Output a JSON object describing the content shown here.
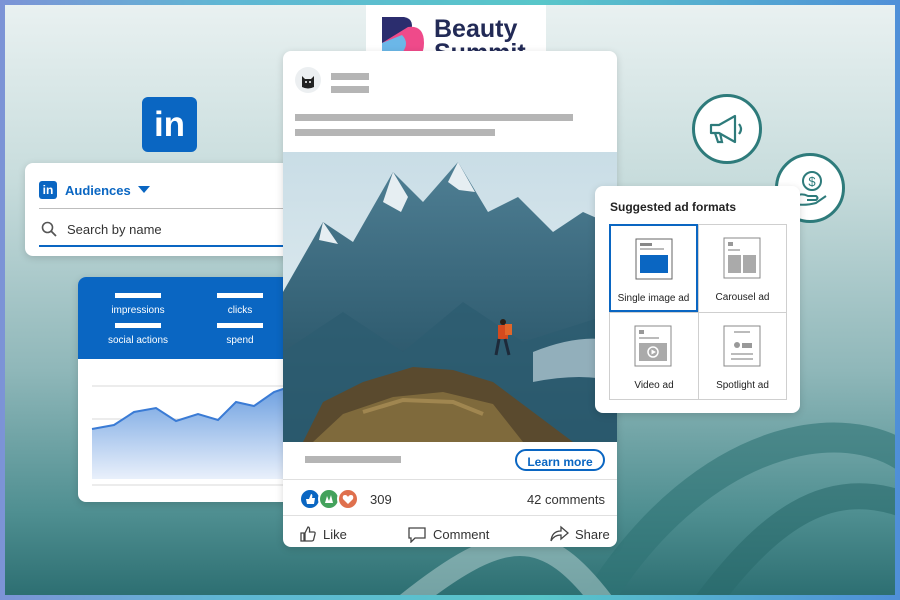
{
  "brand": {
    "name_line1": "Beauty",
    "name_line2": "Summit"
  },
  "linkedin_logo": "in",
  "audiences": {
    "title": "Audiences",
    "search_placeholder": "Search by name"
  },
  "analytics": {
    "metrics": [
      "impressions",
      "clicks",
      "social actions",
      "spend"
    ]
  },
  "post": {
    "cta": "Learn more",
    "reaction_count": "309",
    "comments": "42 comments",
    "actions": {
      "like": "Like",
      "comment": "Comment",
      "share": "Share"
    }
  },
  "ad_formats": {
    "title": "Suggested ad formats",
    "items": [
      "Single image ad",
      "Carousel ad",
      "Video ad",
      "Spotlight ad"
    ],
    "selected": "Single image ad"
  },
  "colors": {
    "linkedin_blue": "#0a66c2",
    "teal": "#2e7b7b",
    "brand_navy": "#222a56"
  },
  "icons": [
    "megaphone-icon",
    "money-hand-icon",
    "search-icon",
    "like-icon",
    "comment-icon",
    "share-icon"
  ]
}
